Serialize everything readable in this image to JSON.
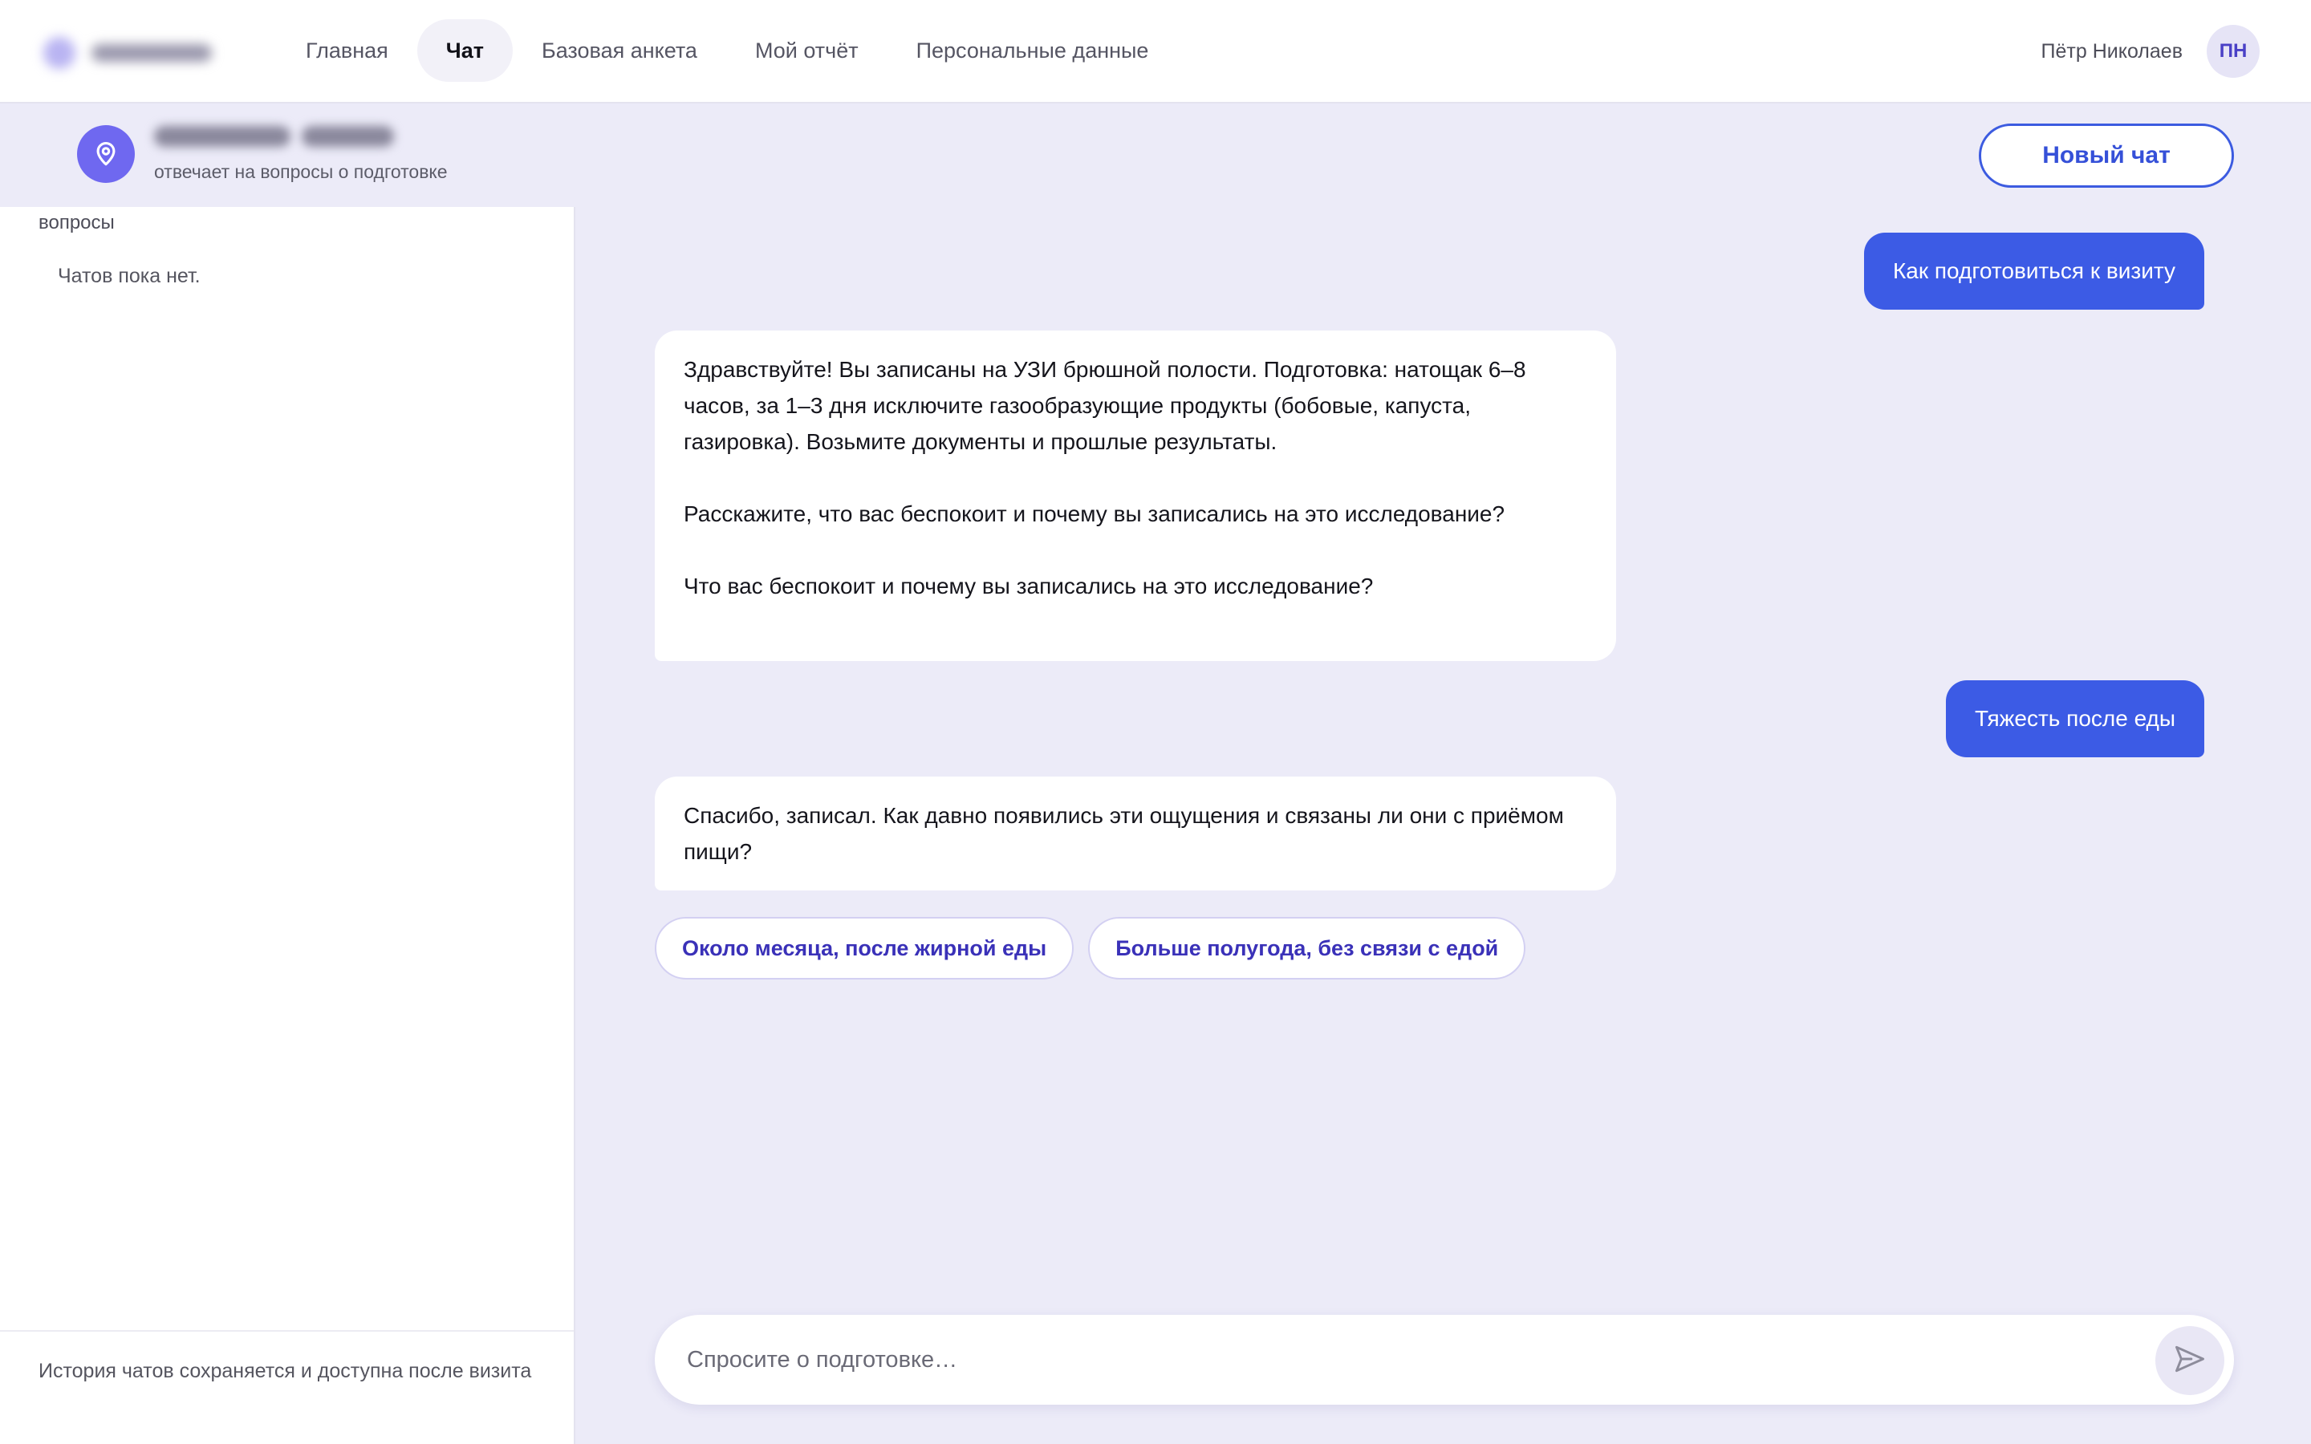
{
  "nav": {
    "items": [
      {
        "label": "Главная",
        "active": false
      },
      {
        "label": "Чат",
        "active": true
      },
      {
        "label": "Базовая анкета",
        "active": false
      },
      {
        "label": "Мой отчёт",
        "active": false
      },
      {
        "label": "Персональные данные",
        "active": false
      }
    ]
  },
  "user": {
    "name": "Пётр Николаев",
    "initials": "ПН"
  },
  "assistant": {
    "subtitle": "отвечает на вопросы о подготовке",
    "icon": "location-pin-icon"
  },
  "actions": {
    "new_chat_label": "Новый чат"
  },
  "sidebar": {
    "section_label": "вопросы",
    "empty_text": "Чатов пока нет.",
    "footer_text": "История чатов сохраняется и доступна после визита"
  },
  "messages": [
    {
      "role": "user",
      "text": "Как подготовиться к визиту"
    },
    {
      "role": "assistant",
      "text": "Здравствуйте! Вы записаны на УЗИ брюшной полости. Подготовка: натощак 6–8 часов, за 1–3 дня исключите газообразующие продукты (бобовые, капуста, газировка). Возьмите документы и прошлые результаты.\n\nРасскажите, что вас беспокоит и почему вы записались на это исследование?\n\nЧто вас беспокоит и почему вы записались на это исследование?"
    },
    {
      "role": "user",
      "text": "Тяжесть после еды"
    },
    {
      "role": "assistant",
      "text": "Спасибо, записал. Как давно появились эти ощущения и связаны ли они с приёмом пищи?"
    }
  ],
  "quick_replies": [
    "Около месяца, после жирной еды",
    "Больше полугода, без связи с едой"
  ],
  "composer": {
    "placeholder": "Спросите о подготовке…",
    "value": "",
    "send_icon": "send-icon"
  },
  "colors": {
    "accent": "#3C5BE5",
    "assistant_icon_bg": "#6F68F0",
    "page_bg": "#ECEBF8",
    "quick_reply_text": "#3A31B8"
  }
}
